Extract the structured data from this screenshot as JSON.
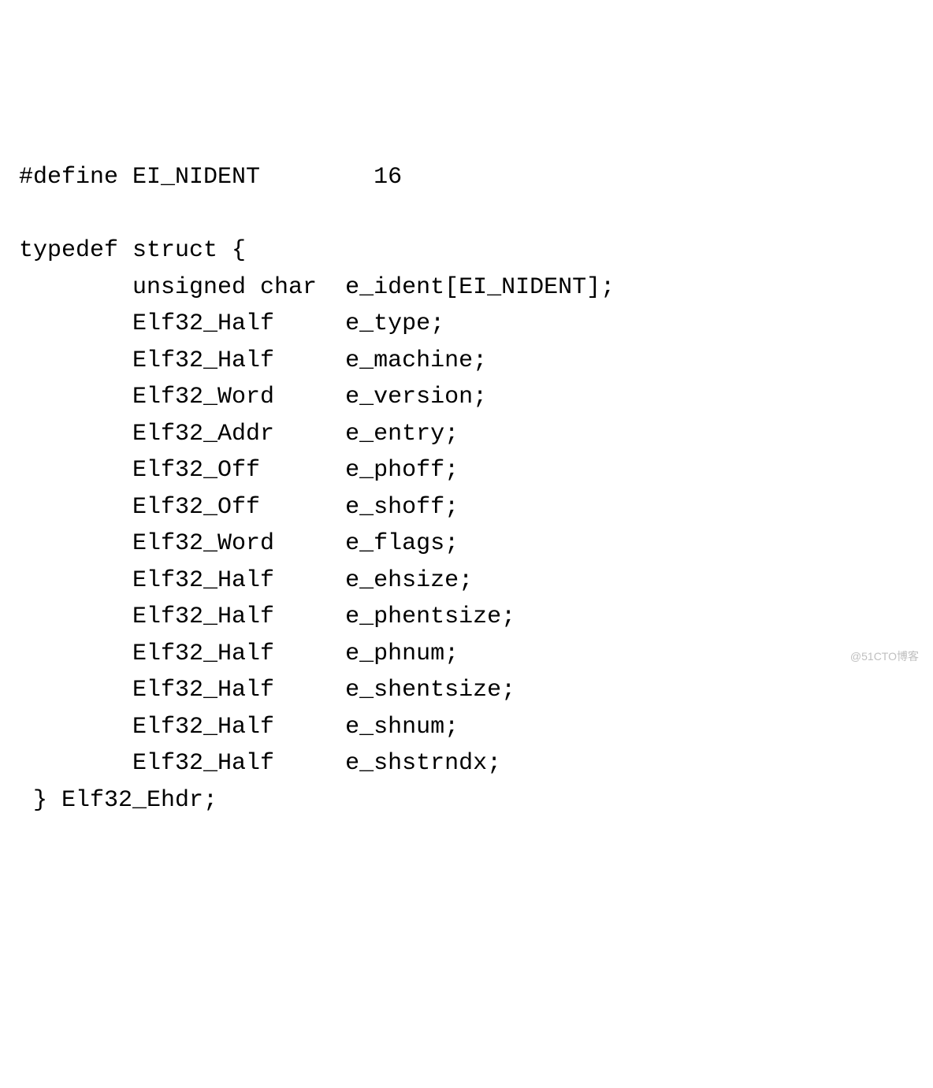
{
  "code": {
    "define_line": "#define EI_NIDENT        16",
    "blank1": "",
    "typedef_open": "typedef struct {",
    "members": [
      {
        "type": "unsigned char",
        "name": "e_ident[EI_NIDENT];"
      },
      {
        "type": "Elf32_Half",
        "name": "e_type;"
      },
      {
        "type": "Elf32_Half",
        "name": "e_machine;"
      },
      {
        "type": "Elf32_Word",
        "name": "e_version;"
      },
      {
        "type": "Elf32_Addr",
        "name": "e_entry;"
      },
      {
        "type": "Elf32_Off",
        "name": "e_phoff;"
      },
      {
        "type": "Elf32_Off",
        "name": "e_shoff;"
      },
      {
        "type": "Elf32_Word",
        "name": "e_flags;"
      },
      {
        "type": "Elf32_Half",
        "name": "e_ehsize;"
      },
      {
        "type": "Elf32_Half",
        "name": "e_phentsize;"
      },
      {
        "type": "Elf32_Half",
        "name": "e_phnum;"
      },
      {
        "type": "Elf32_Half",
        "name": "e_shentsize;"
      },
      {
        "type": "Elf32_Half",
        "name": "e_shnum;"
      },
      {
        "type": "Elf32_Half",
        "name": "e_shstrndx;"
      }
    ],
    "typedef_close": " } Elf32_Ehdr;",
    "indent_member": "        ",
    "type_col_width": 15
  },
  "watermark": "@51CTO博客"
}
